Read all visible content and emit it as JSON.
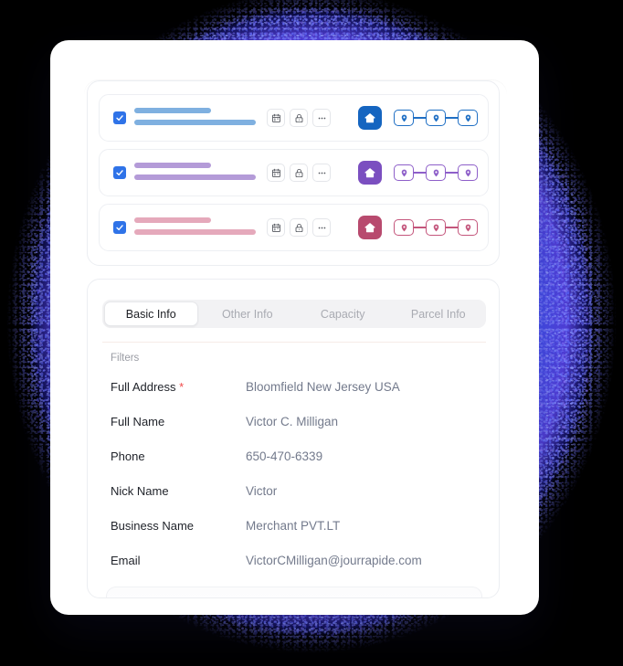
{
  "theme": {
    "background": "#000000",
    "card_background": "#ffffff",
    "accent_blue": "#2f73e8",
    "text_primary": "#21242b",
    "text_secondary": "#737a8c",
    "text_muted": "#9a9ca4",
    "required_red": "#f04a4a",
    "row_colors": [
      "#7fb0e0",
      "#b49bd8",
      "#e5a9bb"
    ],
    "home_tile_colors": [
      "#1565c0",
      "#7b4fc0",
      "#b84a6e"
    ],
    "pin_colors": [
      "#1f6fc4",
      "#8e5fc9",
      "#c4567c"
    ]
  },
  "rows": [
    {
      "checkbox_checked": true,
      "checkbox_icon": "check-icon",
      "bar_color": "#7fb0e0",
      "actions": [
        {
          "icon": "calendar-icon",
          "name": "calendar-button"
        },
        {
          "icon": "lock-icon",
          "name": "lock-button"
        },
        {
          "icon": "more-horizontal-icon",
          "name": "more-options-button"
        }
      ],
      "home_icon": "home-icon",
      "home_color": "#1565c0",
      "pin_color": "#1f6fc4",
      "pin_count": 3,
      "pin_icon": "map-pin-icon"
    },
    {
      "checkbox_checked": true,
      "checkbox_icon": "check-icon",
      "bar_color": "#b49bd8",
      "actions": [
        {
          "icon": "calendar-icon",
          "name": "calendar-button"
        },
        {
          "icon": "lock-icon",
          "name": "lock-button"
        },
        {
          "icon": "more-horizontal-icon",
          "name": "more-options-button"
        }
      ],
      "home_icon": "home-icon",
      "home_color": "#7b4fc0",
      "pin_color": "#8e5fc9",
      "pin_count": 3,
      "pin_icon": "map-pin-icon"
    },
    {
      "checkbox_checked": true,
      "checkbox_icon": "check-icon",
      "bar_color": "#e5a9bb",
      "actions": [
        {
          "icon": "calendar-icon",
          "name": "calendar-button"
        },
        {
          "icon": "lock-icon",
          "name": "lock-button"
        },
        {
          "icon": "more-horizontal-icon",
          "name": "more-options-button"
        }
      ],
      "home_icon": "home-icon",
      "home_color": "#b84a6e",
      "pin_color": "#c4567c",
      "pin_count": 3,
      "pin_icon": "map-pin-icon"
    }
  ],
  "detail": {
    "tabs": [
      {
        "label": "Basic Info",
        "active": true
      },
      {
        "label": "Other Info",
        "active": false
      },
      {
        "label": "Capacity",
        "active": false
      },
      {
        "label": "Parcel Info",
        "active": false
      }
    ],
    "filters_label": "Filters",
    "fields": [
      {
        "label": "Full Address",
        "required": true,
        "required_mark": "*",
        "value": "Bloomfield New Jersey USA"
      },
      {
        "label": "Full Name",
        "required": false,
        "required_mark": "",
        "value": "Victor C. Milligan"
      },
      {
        "label": "Phone",
        "required": false,
        "required_mark": "",
        "value": "650-470-6339"
      },
      {
        "label": "Nick Name",
        "required": false,
        "required_mark": "",
        "value": "Victor"
      },
      {
        "label": "Business Name",
        "required": false,
        "required_mark": "",
        "value": "Merchant PVT.LT"
      },
      {
        "label": "Email",
        "required": false,
        "required_mark": "",
        "value": "VictorCMilligan@jourrapide.com"
      }
    ]
  }
}
